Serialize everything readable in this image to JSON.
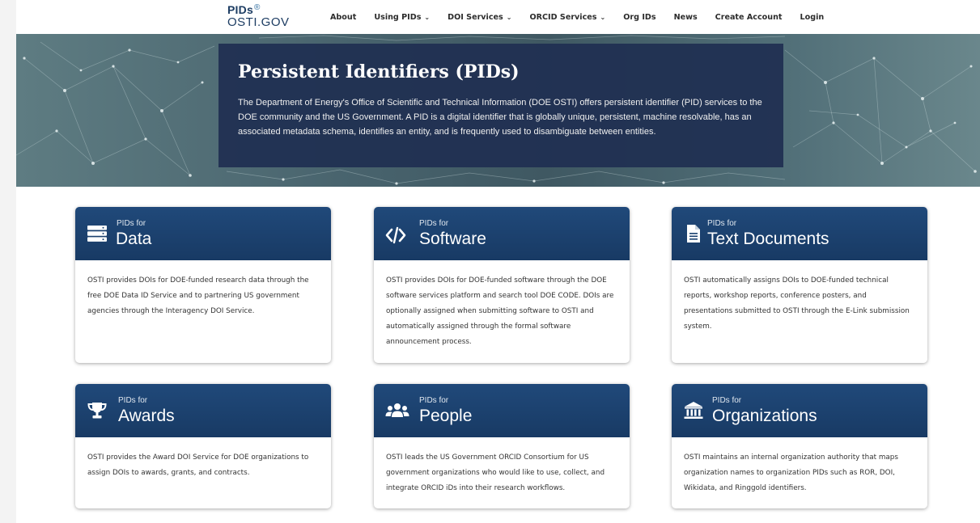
{
  "logo": {
    "line1": "PIDs",
    "reg_mark": "®",
    "line2": "OSTI.GOV"
  },
  "nav": [
    {
      "label": "About",
      "dropdown": false
    },
    {
      "label": "Using PIDs",
      "dropdown": true
    },
    {
      "label": "DOI Services",
      "dropdown": true
    },
    {
      "label": "ORCID Services",
      "dropdown": true
    },
    {
      "label": "Org IDs",
      "dropdown": false
    },
    {
      "label": "News",
      "dropdown": false
    },
    {
      "label": "Create Account",
      "dropdown": false
    },
    {
      "label": "Login",
      "dropdown": false
    }
  ],
  "hero": {
    "title": "Persistent Identifiers (PIDs)",
    "description": "The Department of Energy's Office of Scientific and Technical Information (DOE OSTI) offers persistent identifier (PID) services to the DOE community and the US Government. A PID is a digital identifier that is globally unique, persistent, machine resolvable, has an associated metadata schema, identifies an entity, and is frequently used to disambiguate between entities."
  },
  "cards": [
    {
      "icon": "server-icon",
      "small": "PIDs for",
      "title": "Data",
      "body": "OSTI provides DOIs for DOE-funded research data through the free DOE Data ID Service and to partnering US government agencies through the Interagency DOI Service."
    },
    {
      "icon": "code-icon",
      "small": "PIDs for",
      "title": "Software",
      "body": "OSTI provides DOIs for DOE-funded software through the DOE software services platform and search tool DOE CODE. DOIs are optionally assigned when submitting software to OSTI and automatically assigned through the formal software announcement process."
    },
    {
      "icon": "document-icon",
      "small": "PIDs for",
      "title": "Text Documents",
      "body": "OSTI automatically assigns DOIs to DOE-funded technical reports, workshop reports, conference posters, and presentations submitted to OSTI through the E-Link submission system."
    },
    {
      "icon": "trophy-icon",
      "small": "PIDs for",
      "title": "Awards",
      "body": "OSTI provides the Award DOI Service for DOE organizations to assign DOIs to awards, grants, and contracts."
    },
    {
      "icon": "people-icon",
      "small": "PIDs for",
      "title": "People",
      "body": "OSTI leads the US Government ORCID Consortium for US government organizations who would like to use, collect, and integrate ORCID iDs into their research workflows."
    },
    {
      "icon": "landmark-icon",
      "small": "PIDs for",
      "title": "Organizations",
      "body": "OSTI maintains an internal organization authority that maps organization names to organization PIDs such as ROR, DOI, Wikidata, and Ringgold identifiers."
    }
  ]
}
